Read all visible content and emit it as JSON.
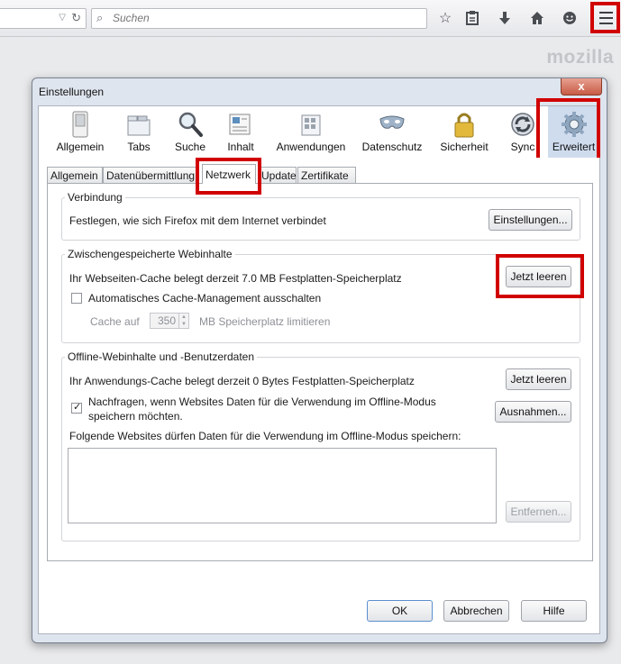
{
  "browser": {
    "search_placeholder": "Suchen",
    "brand": "mozilla",
    "toolbar_icons": [
      "bookmark-star-icon",
      "bookmarks-list-icon",
      "download-icon",
      "home-icon",
      "social-chat-icon",
      "hamburger-menu-icon"
    ]
  },
  "dialog": {
    "title": "Einstellungen",
    "close_label": "x",
    "panes": [
      {
        "label": "Allgemein",
        "icon": "switch-icon"
      },
      {
        "label": "Tabs",
        "icon": "tabs-icon"
      },
      {
        "label": "Suche",
        "icon": "magnifier-icon"
      },
      {
        "label": "Inhalt",
        "icon": "content-icon"
      },
      {
        "label": "Anwendungen",
        "icon": "applications-icon"
      },
      {
        "label": "Datenschutz",
        "icon": "mask-icon"
      },
      {
        "label": "Sicherheit",
        "icon": "padlock-icon"
      },
      {
        "label": "Sync",
        "icon": "sync-icon"
      },
      {
        "label": "Erweitert",
        "icon": "gear-icon"
      }
    ],
    "subtabs": [
      "Allgemein",
      "Datenübermittlung",
      "Netzwerk",
      "Update",
      "Zertifikate"
    ],
    "connection": {
      "title": "Verbindung",
      "text": "Festlegen, wie sich Firefox mit dem Internet verbindet",
      "button": "Einstellungen..."
    },
    "cache": {
      "title": "Zwischengespeicherte Webinhalte",
      "text": "Ihr Webseiten-Cache belegt derzeit 7.0 MB Festplatten-Speicherplatz",
      "button": "Jetzt leeren",
      "override_label": "Automatisches Cache-Management ausschalten",
      "limit_prefix": "Cache auf",
      "limit_value": "350",
      "limit_suffix": "MB Speicherplatz limitieren"
    },
    "offline": {
      "title": "Offline-Webinhalte und -Benutzerdaten",
      "text": "Ihr Anwendungs-Cache belegt derzeit 0 Bytes Festplatten-Speicherplatz",
      "button": "Jetzt leeren",
      "ask_line1": "Nachfragen, wenn Websites Daten für die Verwendung im Offline-Modus",
      "ask_line2": "speichern möchten.",
      "exceptions_button": "Ausnahmen...",
      "list_label": "Folgende Websites dürfen Daten für die Verwendung im Offline-Modus speichern:",
      "remove_button": "Entfernen..."
    },
    "footer": {
      "ok": "OK",
      "cancel": "Abbrechen",
      "help": "Hilfe"
    }
  }
}
